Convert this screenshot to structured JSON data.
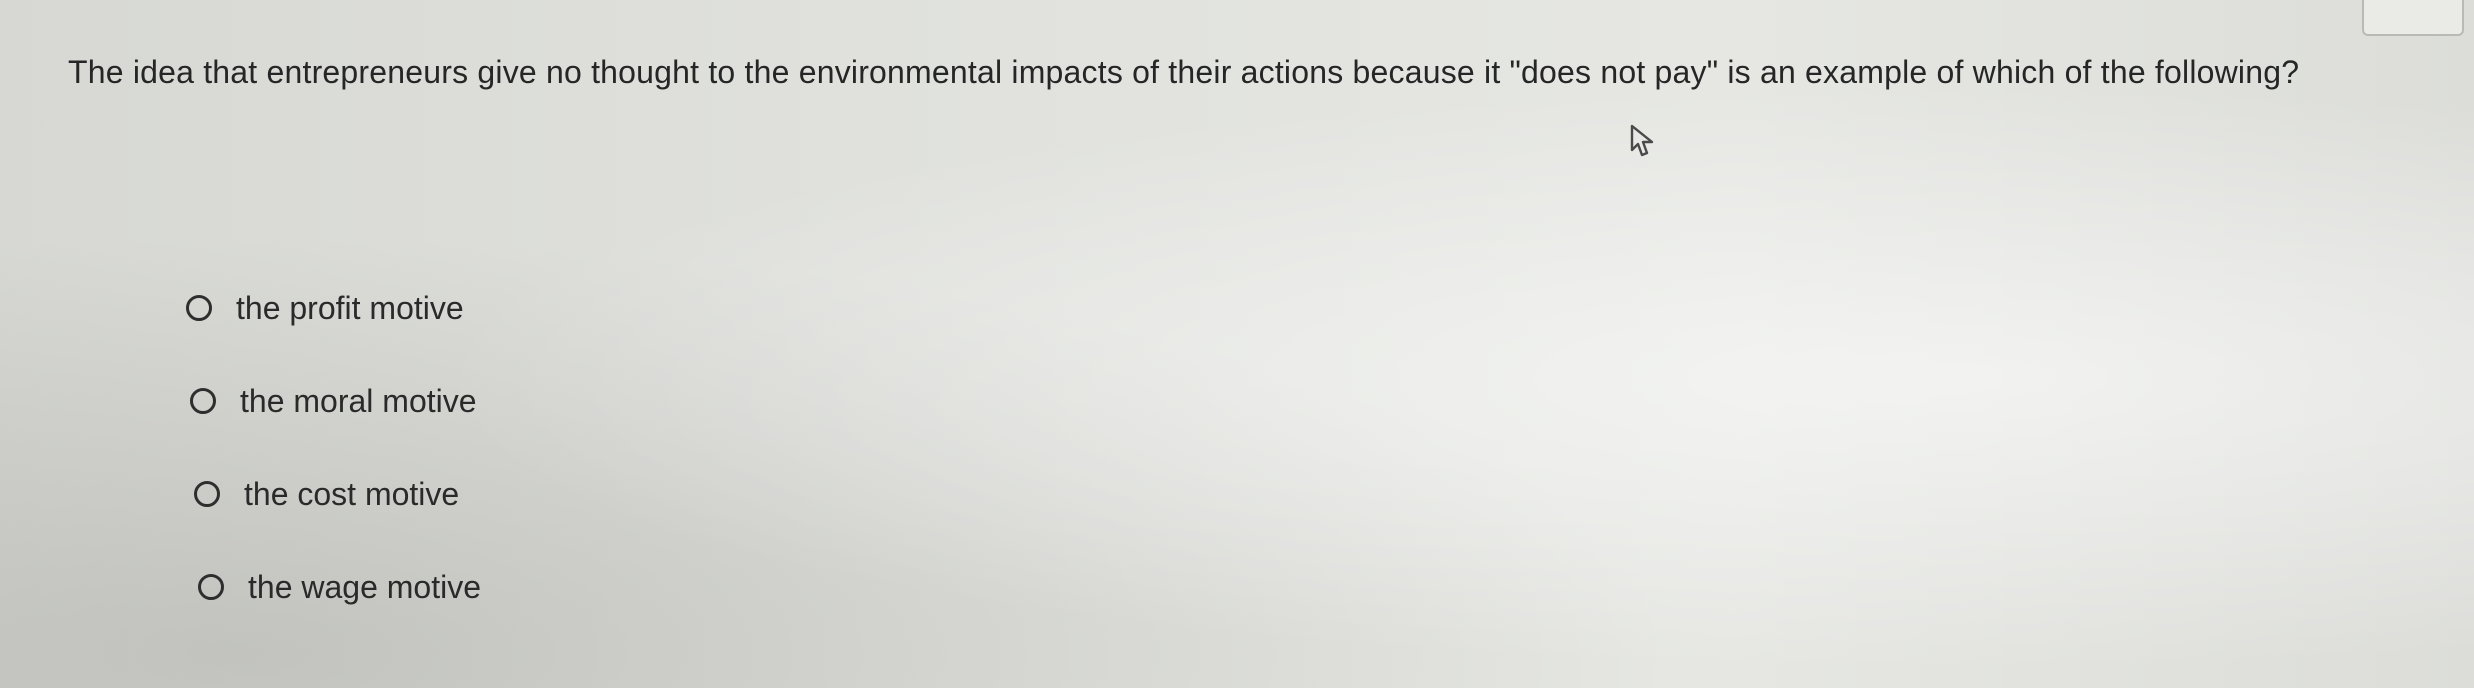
{
  "question": {
    "text": "The idea that entrepreneurs give no thought to the environmental impacts of their actions because it \"does not pay\" is an example of which of the following?"
  },
  "options": [
    {
      "label": "the profit motive"
    },
    {
      "label": "the moral motive"
    },
    {
      "label": "the cost motive"
    },
    {
      "label": "the wage motive"
    }
  ],
  "icons": {
    "pointer": "mouse-pointer-icon",
    "radio": "radio-button-unselected"
  }
}
